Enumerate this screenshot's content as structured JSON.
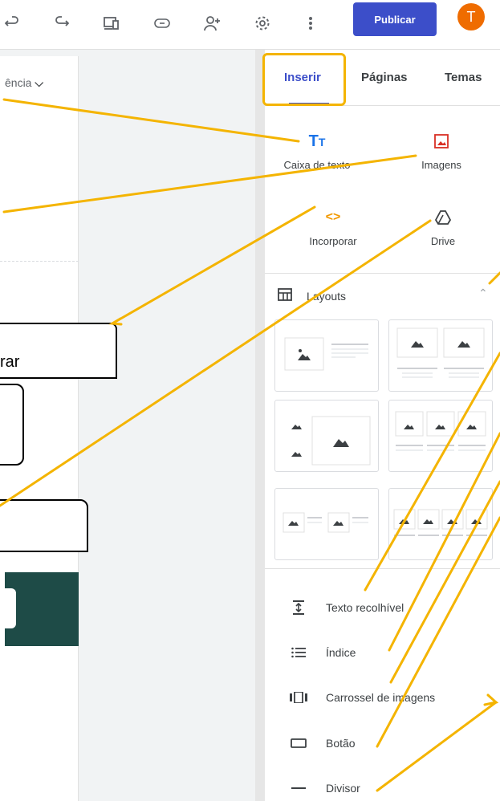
{
  "toolbar": {
    "undo_icon": "undo-icon",
    "redo_icon": "redo-icon",
    "preview_icon": "preview-devices-icon",
    "link_icon": "link-icon",
    "share_icon": "add-person-icon",
    "settings_icon": "gear-icon",
    "more_icon": "more-vert-icon",
    "publish_label": "Publicar",
    "avatar_letter": "T",
    "accent": "#3c4ec9",
    "avatar_color": "#ef6c00"
  },
  "canvas": {
    "theme_link": "ência",
    "callout_embed": "rar",
    "block_color": "#1e4b47"
  },
  "panel": {
    "tabs": [
      "Inserir",
      "Páginas",
      "Temas"
    ],
    "insert_items": [
      {
        "label": "Caixa de texto",
        "icon": "text-box-icon"
      },
      {
        "label": "Imagens",
        "icon": "image-icon"
      },
      {
        "label": "Incorporar",
        "icon": "embed-icon"
      },
      {
        "label": "Drive",
        "icon": "drive-icon"
      }
    ],
    "layouts_label": "Layouts",
    "components": [
      {
        "label": "Texto recolhível",
        "icon": "collapsible-text-icon"
      },
      {
        "label": "Índice",
        "icon": "table-of-contents-icon"
      },
      {
        "label": "Carrossel de imagens",
        "icon": "carousel-icon"
      },
      {
        "label": "Botão",
        "icon": "button-icon"
      },
      {
        "label": "Divisor",
        "icon": "divider-icon"
      }
    ]
  },
  "annotation_color": "#f4b400"
}
